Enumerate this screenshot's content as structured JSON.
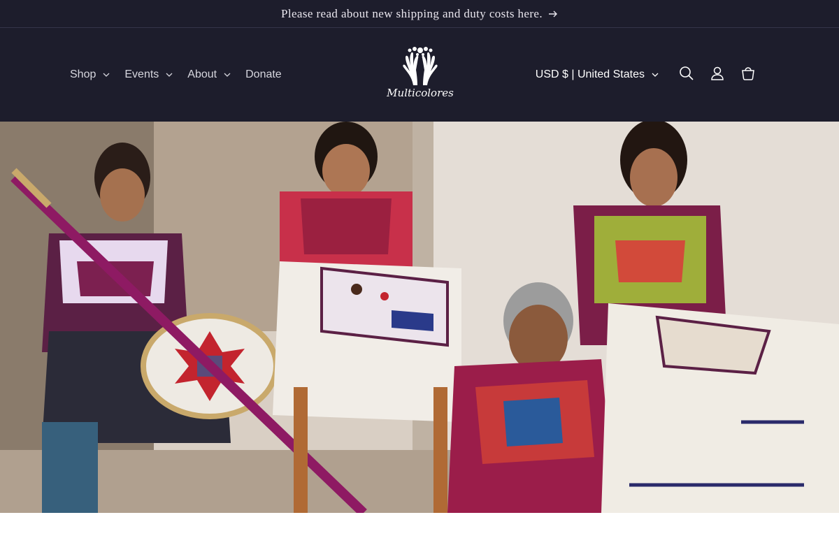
{
  "announcement": {
    "text": "Please read about new shipping and duty costs here."
  },
  "nav": {
    "items": [
      {
        "label": "Shop"
      },
      {
        "label": "Events"
      },
      {
        "label": "About"
      },
      {
        "label": "Donate"
      }
    ]
  },
  "logo": {
    "text": "Multicolores"
  },
  "header_right": {
    "locale": "USD $ | United States",
    "icons": [
      "search-icon",
      "account-icon",
      "cart-icon"
    ]
  },
  "colors": {
    "header_bg": "#1d1d2c",
    "nav_text": "#d6d6de",
    "white": "#ffffff"
  }
}
